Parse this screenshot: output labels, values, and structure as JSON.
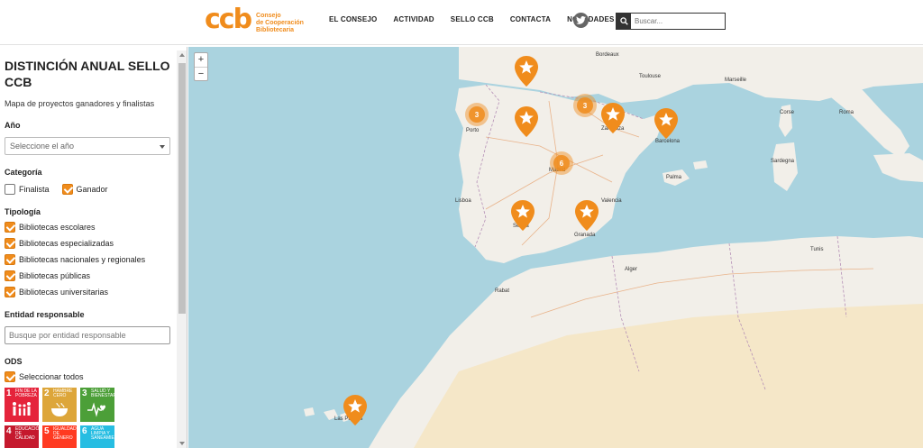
{
  "header": {
    "logo_mark": "ccb",
    "logo_lines": [
      "Consejo",
      "de Cooperación",
      "Bibliotecaria"
    ],
    "nav": [
      "EL CONSEJO",
      "ACTIVIDAD",
      "SELLO CCB",
      "CONTACTA",
      "NOVEDADES"
    ],
    "search_placeholder": "Buscar...",
    "icons": {
      "social": "twitter-icon",
      "search": "search-icon"
    }
  },
  "sidebar": {
    "title": "DISTINCIÓN ANUAL SELLO CCB",
    "subtitle": "Mapa de proyectos ganadores y finalistas",
    "year": {
      "label": "Año",
      "placeholder": "Seleccione el año"
    },
    "category": {
      "label": "Categoría",
      "options": [
        {
          "label": "Finalista",
          "checked": false
        },
        {
          "label": "Ganador",
          "checked": true
        }
      ]
    },
    "typology": {
      "label": "Tipología",
      "options": [
        {
          "label": "Bibliotecas escolares",
          "checked": true
        },
        {
          "label": "Bibliotecas especializadas",
          "checked": true
        },
        {
          "label": "Bibliotecas nacionales y regionales",
          "checked": true
        },
        {
          "label": "Bibliotecas públicas",
          "checked": true
        },
        {
          "label": "Bibliotecas universitarias",
          "checked": true
        }
      ]
    },
    "entity": {
      "label": "Entidad responsable",
      "placeholder": "Busque por entidad responsable"
    },
    "ods": {
      "label": "ODS",
      "select_all": "Seleccionar todos",
      "tiles": [
        {
          "num": "1",
          "text": "FIN DE LA POBREZA",
          "color": "#e5243b"
        },
        {
          "num": "2",
          "text": "HAMBRE CERO",
          "color": "#dda63a"
        },
        {
          "num": "3",
          "text": "SALUD Y BIENESTAR",
          "color": "#4c9f38"
        },
        {
          "num": "4",
          "text": "EDUCACIÓN DE CALIDAD",
          "color": "#c5192d"
        },
        {
          "num": "5",
          "text": "IGUALDAD DE GÉNERO",
          "color": "#ff3a21"
        },
        {
          "num": "6",
          "text": "AGUA LIMPIA Y SANEAMIENTO",
          "color": "#26bde2"
        }
      ]
    }
  },
  "map": {
    "zoom_in": "+",
    "zoom_out": "−",
    "clusters": [
      "3",
      "3",
      "6"
    ],
    "places": [
      "Bordeaux",
      "Toulouse",
      "Marseille",
      "Zaragoza",
      "Barcelona",
      "Madrid",
      "Valencia",
      "Sevilla",
      "Granada",
      "Porto",
      "Lisboa",
      "Palma",
      "Alger",
      "Tunis",
      "Rabat",
      "Roma",
      "Sardegna",
      "Corse",
      "Las Palmas"
    ],
    "colors": {
      "sea": "#aad3df",
      "land": "#f2efe9",
      "desert": "#f5e7c8",
      "accent": "#f08c1c"
    }
  }
}
